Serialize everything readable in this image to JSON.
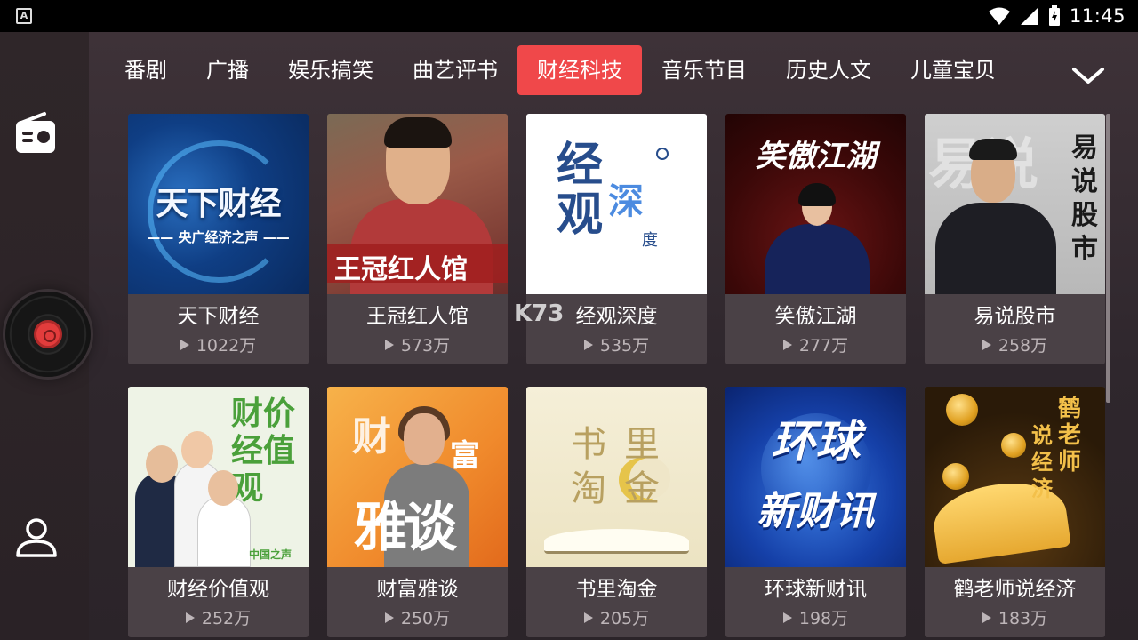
{
  "status_bar": {
    "time": "11:45"
  },
  "sidebar": {
    "items": [
      {
        "name": "radio-icon"
      },
      {
        "name": "record-disc-icon"
      },
      {
        "name": "user-icon"
      }
    ]
  },
  "tabs": {
    "items": [
      {
        "label": "番剧",
        "active": false
      },
      {
        "label": "广播",
        "active": false
      },
      {
        "label": "娱乐搞笑",
        "active": false
      },
      {
        "label": "曲艺评书",
        "active": false
      },
      {
        "label": "财经科技",
        "active": true
      },
      {
        "label": "音乐节目",
        "active": false
      },
      {
        "label": "历史人文",
        "active": false
      },
      {
        "label": "儿童宝贝",
        "active": false
      }
    ],
    "active_color": "#f0484a"
  },
  "cards": [
    {
      "title": "天下财经",
      "plays": "1022万",
      "cover_text": "天下财经",
      "cover_sub": "—— 央广经济之声 ——"
    },
    {
      "title": "王冠红人馆",
      "plays": "573万",
      "cover_text": "王冠红人馆"
    },
    {
      "title": "经观深度",
      "plays": "535万",
      "cover_text_a": "经观",
      "cover_text_b": "深",
      "cover_text_c": "度"
    },
    {
      "title": "笑傲江湖",
      "plays": "277万",
      "cover_text": "笑傲江湖"
    },
    {
      "title": "易说股市",
      "plays": "258万",
      "cover_text": "易说股市",
      "cover_bg": "易说"
    },
    {
      "title": "财经价值观",
      "plays": "252万",
      "cover_text": "财价经值观",
      "cover_tag": "中国之声"
    },
    {
      "title": "财富雅谈",
      "plays": "250万",
      "cover_a": "财",
      "cover_b": "富",
      "cover_c": "雅谈"
    },
    {
      "title": "书里淘金",
      "plays": "205万",
      "cover_text": "书里淘金"
    },
    {
      "title": "环球新财讯",
      "plays": "198万",
      "cover_a": "环球",
      "cover_b": "新财讯"
    },
    {
      "title": "鹤老师说经济",
      "plays": "183万",
      "cover_a": "鹤老师",
      "cover_b": "说经济"
    }
  ],
  "watermark": "K73"
}
